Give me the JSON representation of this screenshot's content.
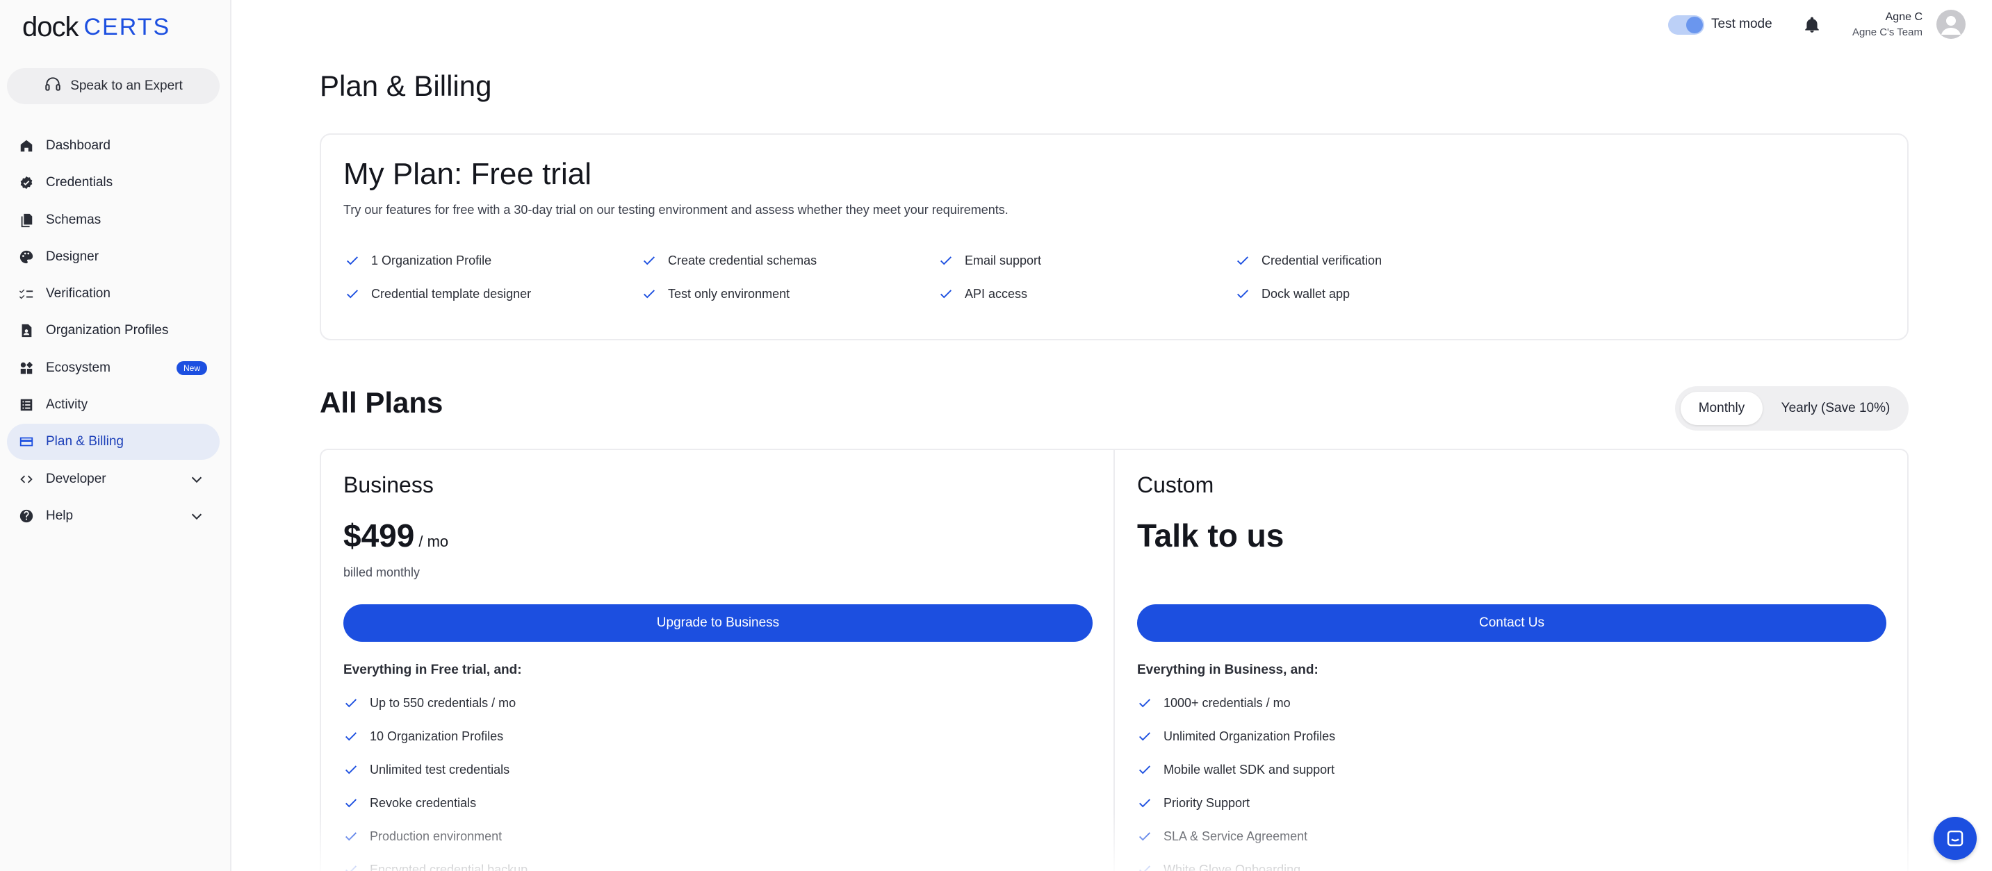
{
  "brand": {
    "logo_main": "dock",
    "logo_sub": "CERTS",
    "accent": "#1c4fe0"
  },
  "sidebar": {
    "expert_label": "Speak to an Expert",
    "items": [
      {
        "label": "Dashboard",
        "icon": "home-icon"
      },
      {
        "label": "Credentials",
        "icon": "badge-check-icon"
      },
      {
        "label": "Schemas",
        "icon": "documents-icon"
      },
      {
        "label": "Designer",
        "icon": "palette-icon"
      },
      {
        "label": "Verification",
        "icon": "checklist-icon"
      },
      {
        "label": "Organization Profiles",
        "icon": "profile-document-icon"
      },
      {
        "label": "Ecosystem",
        "icon": "ecosystem-icon",
        "badge": "New"
      },
      {
        "label": "Activity",
        "icon": "activity-list-icon"
      },
      {
        "label": "Plan & Billing",
        "icon": "credit-card-icon",
        "active": true
      },
      {
        "label": "Developer",
        "icon": "code-icon",
        "expandable": true
      },
      {
        "label": "Help",
        "icon": "help-circle-icon",
        "expandable": true
      }
    ]
  },
  "topbar": {
    "test_mode_label": "Test mode",
    "test_mode_on": true,
    "user_name": "Agne C",
    "team_name": "Agne C's Team"
  },
  "page": {
    "title": "Plan & Billing"
  },
  "my_plan": {
    "title": "My Plan: Free trial",
    "description": "Try our features for free with a 30-day trial on our testing environment and assess whether they meet your requirements.",
    "features": [
      "1 Organization Profile",
      "Create credential schemas",
      "Email support",
      "Credential verification",
      "Credential template designer",
      "Test only environment",
      "API access",
      "Dock wallet app"
    ]
  },
  "all_plans": {
    "title": "All Plans",
    "billing_options": [
      "Monthly",
      "Yearly (Save 10%)"
    ],
    "selected_billing": "Monthly",
    "plans": [
      {
        "name": "Business",
        "price": "$499",
        "price_unit": "/ mo",
        "billed": "billed monthly",
        "cta": "Upgrade to Business",
        "includes": "Everything in Free trial, and:",
        "features": [
          "Up to 550 credentials / mo",
          "10 Organization Profiles",
          "Unlimited test credentials",
          "Revoke credentials",
          "Production environment",
          "Encrypted credential backup"
        ]
      },
      {
        "name": "Custom",
        "headline": "Talk to us",
        "cta": "Contact Us",
        "includes": "Everything in Business, and:",
        "features": [
          "1000+ credentials / mo",
          "Unlimited Organization Profiles",
          "Mobile wallet SDK and support",
          "Priority Support",
          "SLA & Service Agreement",
          "White Glove Onboarding"
        ]
      }
    ]
  }
}
